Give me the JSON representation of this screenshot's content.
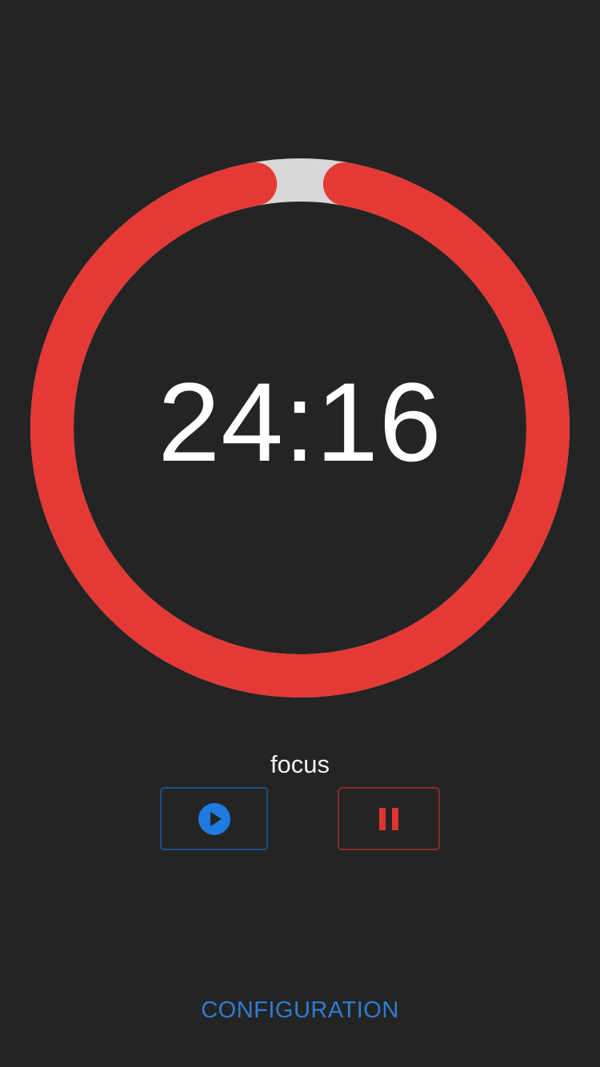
{
  "timer": {
    "time_remaining": "24:16",
    "mode_label": "focus",
    "progress_fraction": 0.97,
    "ring_color": "#e53935",
    "track_color": "#d8d8d8"
  },
  "controls": {
    "play_icon": "play-circle-icon",
    "pause_icon": "pause-icon",
    "play_color": "#1e7be0",
    "pause_color": "#e0342f"
  },
  "footer": {
    "config_label": "CONFIGURATION",
    "config_color": "#2d7dd2"
  }
}
